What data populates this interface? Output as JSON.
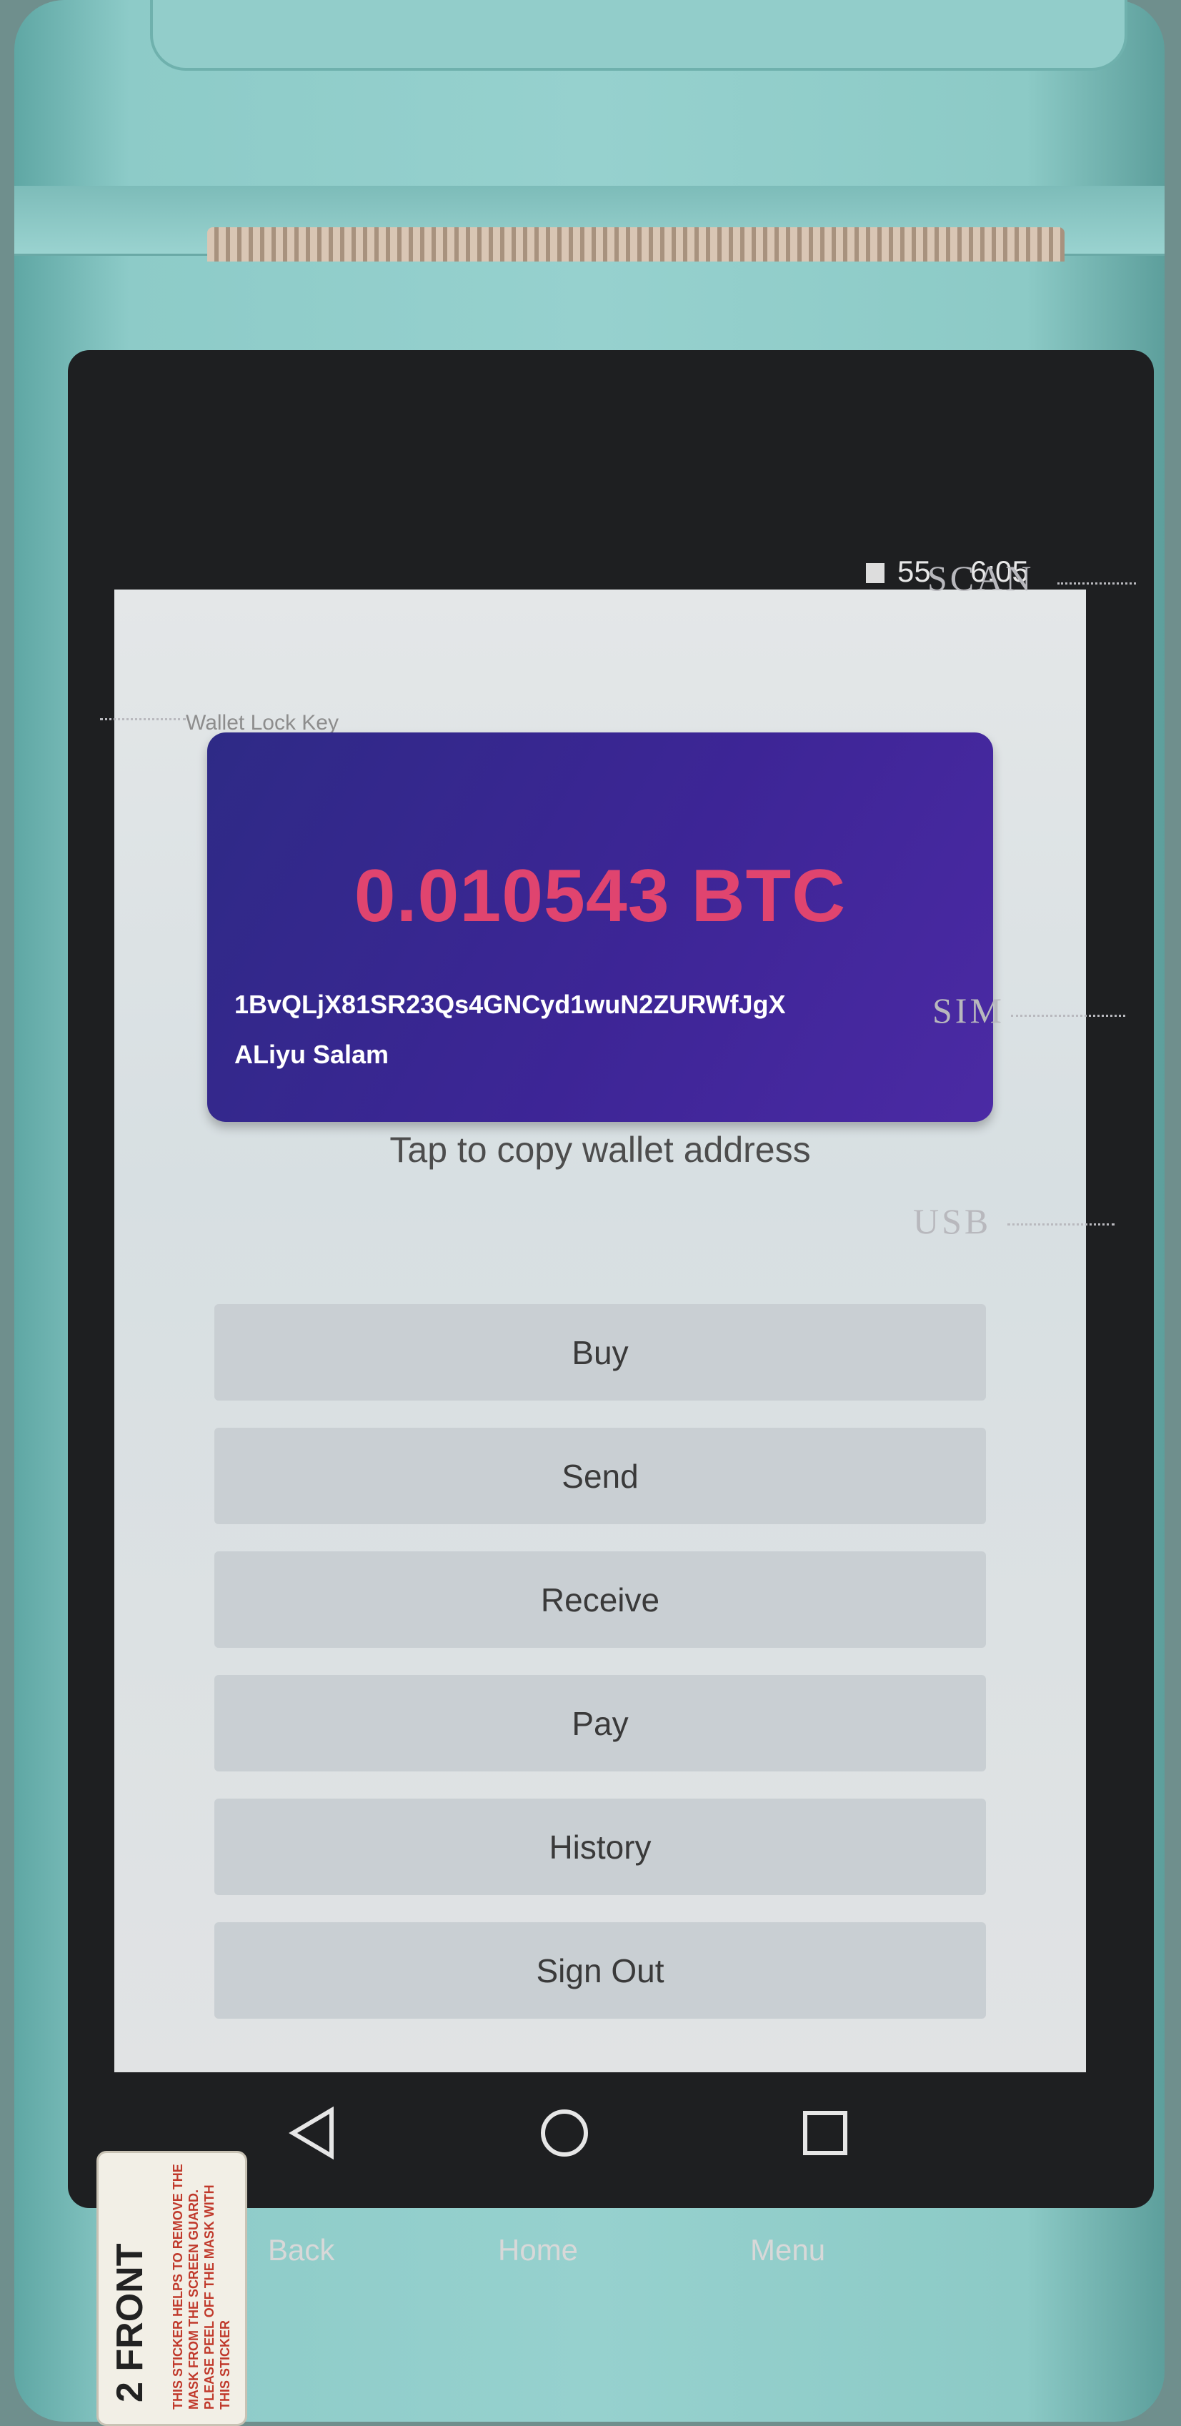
{
  "status_bar": {
    "battery": "55",
    "time": "6:05"
  },
  "device_labels": {
    "scan": "SCAN",
    "sim": "SIM",
    "usb": "USB"
  },
  "wallet": {
    "card_hint": "Wallet Lock Key",
    "balance": "0.010543 BTC",
    "address": "1BvQLjX81SR23Qs4GNCyd1wuN2ZURWfJgX",
    "owner": "ALiyu Salam",
    "copy_hint": "Tap to copy wallet address"
  },
  "actions": [
    {
      "label": "Buy"
    },
    {
      "label": "Send"
    },
    {
      "label": "Receive"
    },
    {
      "label": "Pay"
    },
    {
      "label": "History"
    },
    {
      "label": "Sign Out"
    }
  ],
  "nav": {
    "back": "Back",
    "home": "Home",
    "menu": "Menu"
  },
  "sticker": {
    "number": "2",
    "label": "FRONT",
    "text": "THIS STICKER HELPS TO REMOVE THE MASK FROM THE SCREEN GUARD. PLEASE PEEL OFF THE MASK WITH THIS STICKER"
  },
  "colors": {
    "card_start": "#2e2a86",
    "card_end": "#4b2aa4",
    "balance": "#e0446f",
    "button": "#c9cfd3",
    "device_shell": "#96d1ce"
  }
}
